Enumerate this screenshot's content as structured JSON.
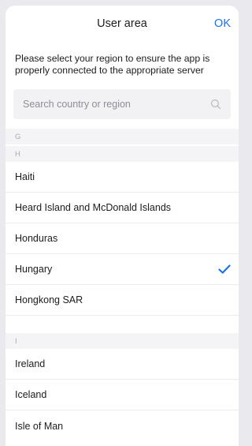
{
  "header": {
    "title": "User area",
    "ok_label": "OK"
  },
  "notice": "Please select your region to ensure the app is properly connected to the appropriate server",
  "search": {
    "placeholder": "Search country or region",
    "value": ""
  },
  "sections": [
    {
      "letter": "G",
      "items": []
    },
    {
      "letter": "H",
      "items": [
        {
          "label": "Haiti",
          "selected": false
        },
        {
          "label": "Heard Island and McDonald Islands",
          "selected": false
        },
        {
          "label": "Honduras",
          "selected": false
        },
        {
          "label": "Hungary",
          "selected": true
        },
        {
          "label": "Hongkong SAR",
          "selected": false
        }
      ]
    },
    {
      "letter": "I",
      "items": [
        {
          "label": "Ireland",
          "selected": false
        },
        {
          "label": "Iceland",
          "selected": false
        },
        {
          "label": "Isle of Man",
          "selected": false
        }
      ]
    }
  ],
  "colors": {
    "accent": "#1a73e8",
    "section_bg": "#f4f4f6",
    "search_bg": "#f2f2f5"
  },
  "icons": {
    "search": "search-icon",
    "selected": "checkmark-icon"
  }
}
